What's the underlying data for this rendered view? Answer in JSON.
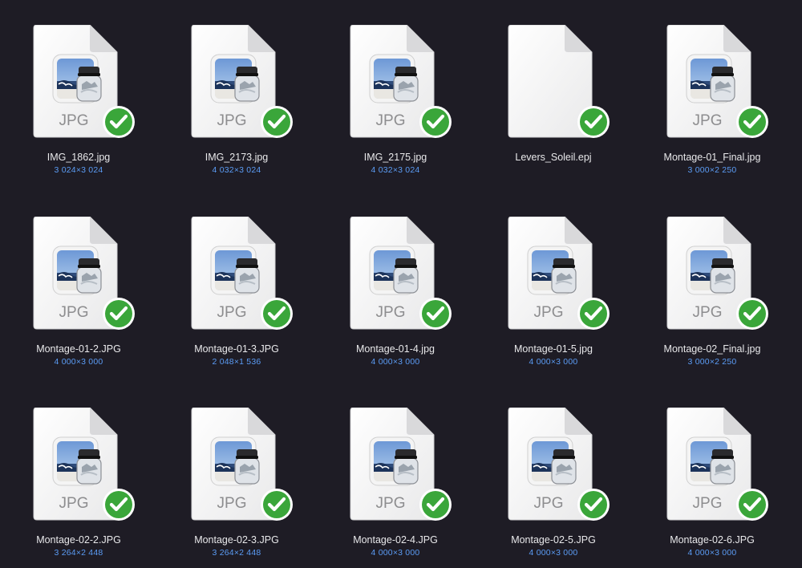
{
  "colors": {
    "background": "#1e1c25",
    "filename_text": "#e8e8ea",
    "dimensions_text": "#5b9cf5",
    "badge_green": "#3aa63a"
  },
  "icons": {
    "document": "document-icon",
    "preview_app": "preview-app-icon",
    "badge": "checkmark-badge-icon"
  },
  "files": [
    {
      "name": "IMG_1862.jpg",
      "dims": "3 024×3 024",
      "type_label": "JPG",
      "kind": "jpg"
    },
    {
      "name": "IMG_2173.jpg",
      "dims": "4 032×3 024",
      "type_label": "JPG",
      "kind": "jpg"
    },
    {
      "name": "IMG_2175.jpg",
      "dims": "4 032×3 024",
      "type_label": "JPG",
      "kind": "jpg"
    },
    {
      "name": "Levers_Soleil.epj",
      "dims": "",
      "type_label": "",
      "kind": "blank"
    },
    {
      "name": "Montage-01_Final.jpg",
      "dims": "3 000×2 250",
      "type_label": "JPG",
      "kind": "jpg"
    },
    {
      "name": "Montage-01-2.JPG",
      "dims": "4 000×3 000",
      "type_label": "JPG",
      "kind": "jpg"
    },
    {
      "name": "Montage-01-3.JPG",
      "dims": "2 048×1 536",
      "type_label": "JPG",
      "kind": "jpg"
    },
    {
      "name": "Montage-01-4.jpg",
      "dims": "4 000×3 000",
      "type_label": "JPG",
      "kind": "jpg"
    },
    {
      "name": "Montage-01-5.jpg",
      "dims": "4 000×3 000",
      "type_label": "JPG",
      "kind": "jpg"
    },
    {
      "name": "Montage-02_Final.jpg",
      "dims": "3 000×2 250",
      "type_label": "JPG",
      "kind": "jpg"
    },
    {
      "name": "Montage-02-2.JPG",
      "dims": "3 264×2 448",
      "type_label": "JPG",
      "kind": "jpg"
    },
    {
      "name": "Montage-02-3.JPG",
      "dims": "3 264×2 448",
      "type_label": "JPG",
      "kind": "jpg"
    },
    {
      "name": "Montage-02-4.JPG",
      "dims": "4 000×3 000",
      "type_label": "JPG",
      "kind": "jpg"
    },
    {
      "name": "Montage-02-5.JPG",
      "dims": "4 000×3 000",
      "type_label": "JPG",
      "kind": "jpg"
    },
    {
      "name": "Montage-02-6.JPG",
      "dims": "4 000×3 000",
      "type_label": "JPG",
      "kind": "jpg"
    }
  ]
}
